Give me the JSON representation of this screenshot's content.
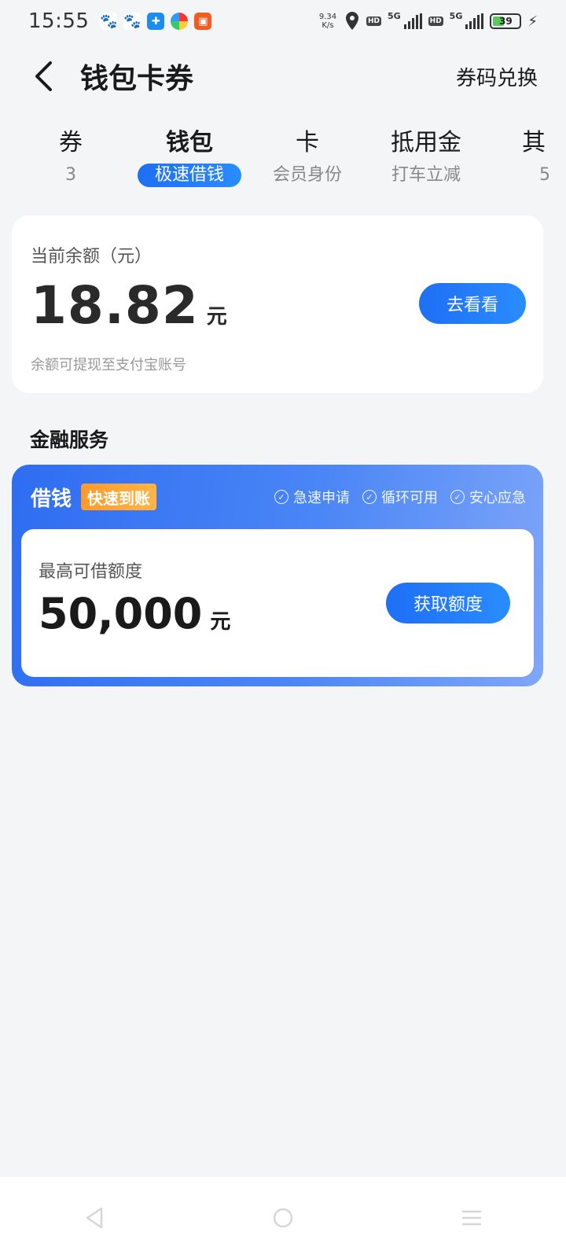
{
  "status_bar": {
    "time": "15:55",
    "net_speed_value": "9.34",
    "net_speed_unit": "K/s",
    "signal_1": "5G",
    "signal_2": "5G",
    "battery": "39",
    "hd": "HD"
  },
  "header": {
    "title": "钱包卡券",
    "redeem_label": "券码兑换"
  },
  "tabs": [
    {
      "title": "券",
      "sub": "3"
    },
    {
      "title": "钱包",
      "sub": "极速借钱"
    },
    {
      "title": "卡",
      "sub": "会员身份"
    },
    {
      "title": "抵用金",
      "sub": "打车立减"
    },
    {
      "title": "其",
      "sub": "5"
    }
  ],
  "balance": {
    "label": "当前余额（元）",
    "amount": "18.82",
    "unit": "元",
    "note": "余额可提现至支付宝账号",
    "button": "去看看"
  },
  "finance": {
    "section_title": "金融服务",
    "loan_title": "借钱",
    "badge": "快速到账",
    "features": [
      "急速申请",
      "循环可用",
      "安心应急"
    ],
    "limit_label": "最高可借额度",
    "limit_amount": "50,000",
    "limit_unit": "元",
    "limit_button": "获取额度"
  },
  "colors": {
    "accent": "#1e6ff5",
    "badge": "#ff9a2a",
    "background": "#f4f5f7"
  }
}
